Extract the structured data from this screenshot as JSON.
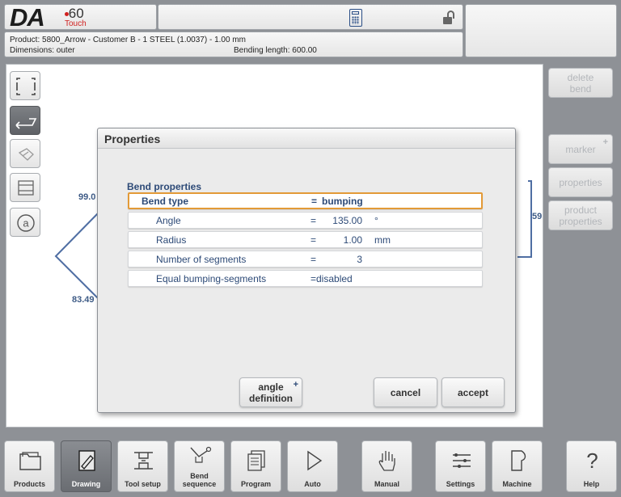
{
  "header": {
    "logo": {
      "brand": "DA",
      "model": "60",
      "sub": "Touch"
    },
    "product_line": "Product: 5800_Arrow - Customer B - 1 STEEL (1.0037) - 1.00 mm",
    "dimensions": "Dimensions: outer",
    "bending_length": "Bending length: 600.00"
  },
  "drawing": {
    "dim_labels": [
      "99.0",
      "83.49",
      "59"
    ]
  },
  "right_panel": {
    "delete_bend": "delete\nbend",
    "marker": "marker",
    "properties": "properties",
    "product_properties": "product\nproperties"
  },
  "dialog": {
    "title": "Properties",
    "section_title": "Bend properties",
    "rows": [
      {
        "name": "Bend type",
        "eq": "=",
        "value": "bumping",
        "unit": ""
      },
      {
        "name": "Angle",
        "eq": "=",
        "value": "135.00",
        "unit": "°"
      },
      {
        "name": "Radius",
        "eq": "=",
        "value": "1.00",
        "unit": "mm"
      },
      {
        "name": "Number of segments",
        "eq": "=",
        "value": "3",
        "unit": ""
      },
      {
        "name": "Equal bumping-segments",
        "eq": "=",
        "value": "disabled",
        "unit": ""
      }
    ],
    "angle_definition": "angle\ndefinition",
    "cancel": "cancel",
    "accept": "accept"
  },
  "nav": {
    "products": "Products",
    "drawing": "Drawing",
    "tool_setup": "Tool setup",
    "bend_sequence": "Bend\nsequence",
    "program": "Program",
    "auto": "Auto",
    "manual": "Manual",
    "settings": "Settings",
    "machine": "Machine",
    "help": "Help"
  },
  "colors": {
    "accent_blue": "#2d4a77",
    "selection_orange": "#e39a37",
    "logo_red": "#d0201f"
  }
}
